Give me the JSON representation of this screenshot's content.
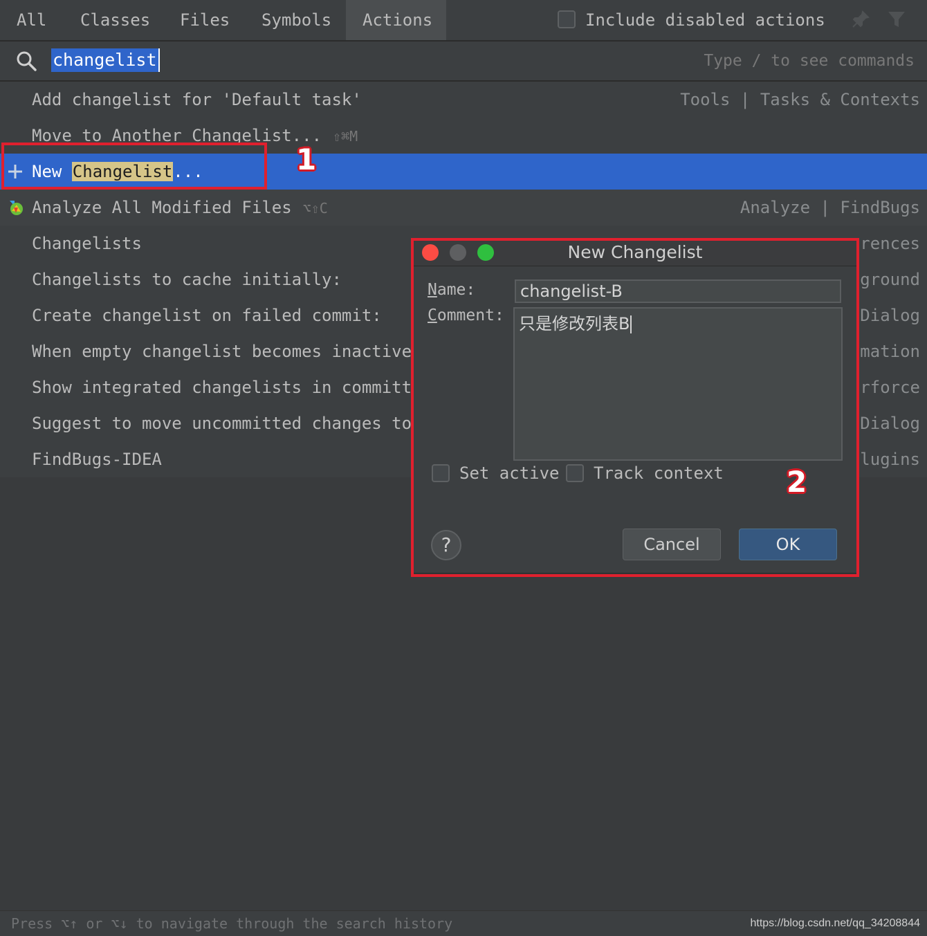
{
  "tabs": [
    {
      "label": "All"
    },
    {
      "label": "Classes"
    },
    {
      "label": "Files"
    },
    {
      "label": "Symbols"
    },
    {
      "label": "Actions",
      "active": true
    }
  ],
  "include_disabled": {
    "label": "Include disabled actions",
    "checked": false
  },
  "search": {
    "query": "changelist",
    "hint": "Type / to see commands"
  },
  "results": [
    {
      "label": "Add changelist for 'Default task'",
      "shortcut": "",
      "category": "Tools | Tasks & Contexts"
    },
    {
      "label": "Move to Another Changelist...",
      "shortcut": "⇧⌘M",
      "category": ""
    },
    {
      "label_prefix": "New ",
      "label_highlight": "Changelist",
      "label_suffix": "...",
      "icon": "plus-icon",
      "selected": true
    },
    {
      "label": "Analyze All Modified Files",
      "shortcut": "⌥⇧C",
      "category": "Analyze | FindBugs",
      "icon": "findbugs-icon"
    },
    {
      "label": "Changelists",
      "category": "erences"
    },
    {
      "label": "Changelists to cache initially:",
      "category": "ground"
    },
    {
      "label": "Create changelist on failed commit:",
      "category": "Dialog"
    },
    {
      "label": "When empty changelist becomes inactive",
      "category": "mation"
    },
    {
      "label": "Show integrated changelists in committe",
      "category": "erforce"
    },
    {
      "label": "Suggest to move uncommitted changes to",
      "category": "Dialog"
    },
    {
      "label": "FindBugs-IDEA",
      "category": "lugins"
    }
  ],
  "annotations": {
    "one": "1",
    "two": "2"
  },
  "dialog": {
    "title": "New Changelist",
    "name_label_u": "N",
    "name_label_rest": "ame:",
    "name_value": "changelist-B",
    "comment_label_u": "C",
    "comment_label_rest": "omment:",
    "comment_value": "只是修改列表B",
    "set_active": {
      "label": "Set active",
      "checked": false
    },
    "track_context": {
      "label": "Track context",
      "checked": false
    },
    "help": "?",
    "cancel": "Cancel",
    "ok": "OK"
  },
  "status": {
    "text": "Press ⌥↑ or ⌥↓ to navigate through the search history",
    "watermark": "https://blog.csdn.net/qq_34208844"
  },
  "colors": {
    "selection": "#2f65ca",
    "highlight": "#d6c588",
    "annotation_red": "#e0202e",
    "ok_button": "#365880"
  }
}
